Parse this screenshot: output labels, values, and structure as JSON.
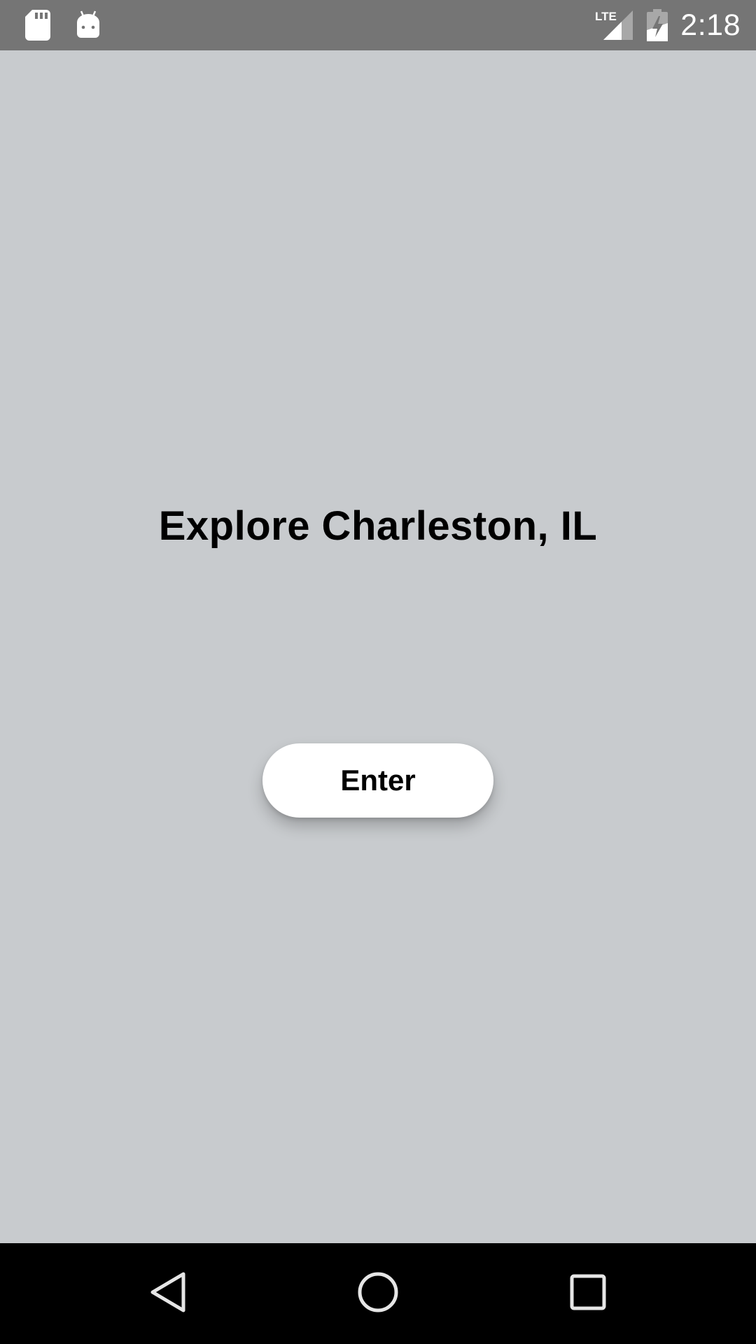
{
  "status_bar": {
    "time": "2:18",
    "network_label": "LTE",
    "icons": [
      "sd-card-icon",
      "android-icon",
      "lte-signal-icon",
      "battery-charging-icon"
    ]
  },
  "main": {
    "headline": "Explore Charleston, IL",
    "enter_label": "Enter"
  },
  "nav_bar": {
    "icons": [
      "back-icon",
      "home-icon",
      "recents-icon"
    ]
  },
  "colors": {
    "background": "#c8cbce",
    "status_bar": "#757575",
    "nav_bar": "#000000",
    "button": "#ffffff"
  }
}
